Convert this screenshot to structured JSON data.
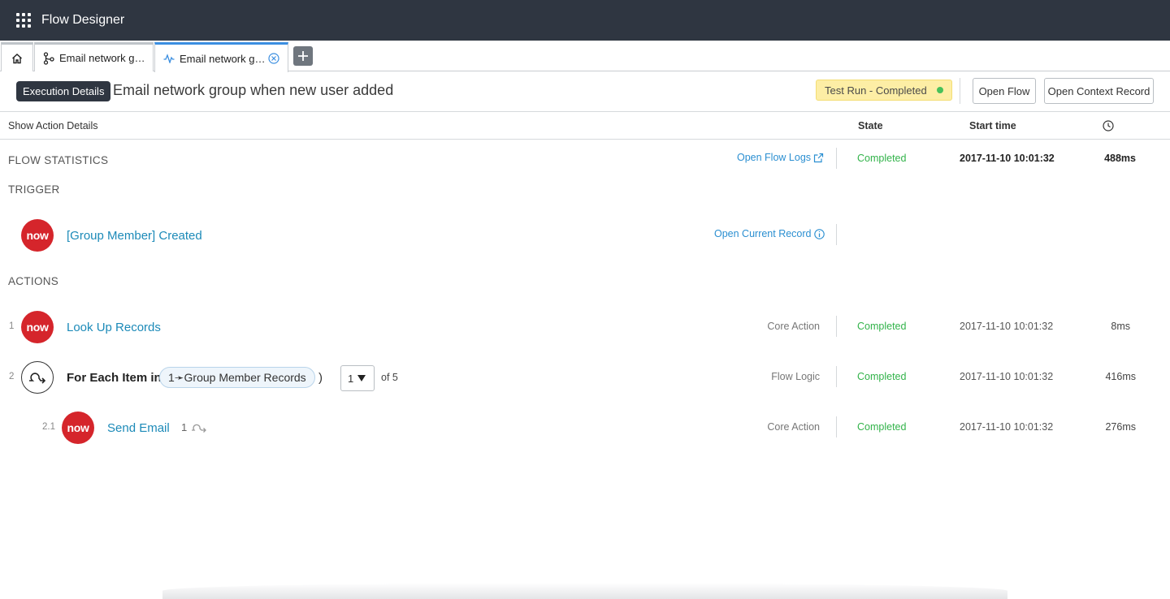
{
  "app": {
    "title": "Flow Designer"
  },
  "tabs": [
    {
      "label": "Email network g…",
      "icon": "flow-diagram-icon"
    },
    {
      "label": "Email network g…",
      "icon": "pulse-icon",
      "active": true
    }
  ],
  "header": {
    "badge": "Execution Details",
    "title": "Email network group when new user added",
    "status": "Test Run - Completed",
    "open_flow": "Open Flow",
    "open_context": "Open Context Record"
  },
  "columns": {
    "show_action_details": "Show Action Details",
    "state": "State",
    "start_time": "Start time",
    "duration_icon": "clock-icon"
  },
  "flow_statistics": {
    "label": "FLOW STATISTICS",
    "link": "Open Flow Logs",
    "state": "Completed",
    "start": "2017-11-10 10:01:32",
    "duration": "488ms"
  },
  "trigger": {
    "label": "TRIGGER",
    "logo": "now",
    "title": "[Group Member] Created",
    "link": "Open Current Record"
  },
  "actions": {
    "label": "ACTIONS",
    "rows": [
      {
        "num": "1",
        "logo": "now",
        "title": "Look Up Records",
        "kind": "Core Action",
        "state": "Completed",
        "start": "2017-11-10 10:01:32",
        "duration": "8ms"
      },
      {
        "num": "2",
        "title": "For Each Item in (",
        "close_paren": ")",
        "pill": "1➛Group Member Records",
        "iteration": "1",
        "of": "of 5",
        "kind": "Flow Logic",
        "state": "Completed",
        "start": "2017-11-10 10:01:32",
        "duration": "416ms"
      },
      {
        "num": "2.1",
        "logo": "now",
        "title": "Send Email",
        "iteration_count": "1",
        "kind": "Core Action",
        "state": "Completed",
        "start": "2017-11-10 10:01:32",
        "duration": "276ms"
      }
    ]
  },
  "colors": {
    "topbar": "#2f3641",
    "link": "#2b8fd1",
    "completed": "#32b34a",
    "brand": "#d5252b",
    "status_bg": "#fdeea5"
  }
}
